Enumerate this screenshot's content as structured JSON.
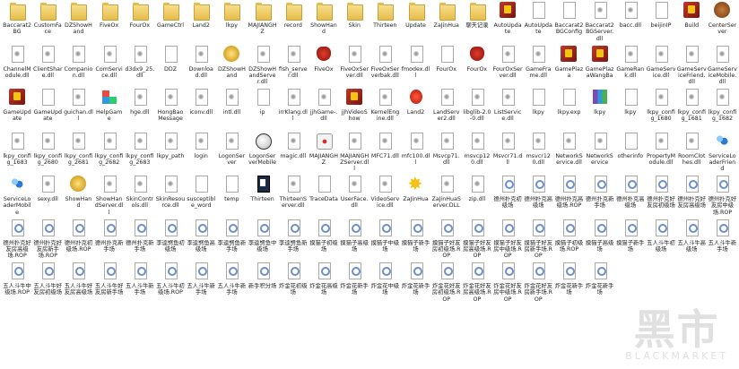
{
  "items": [
    {
      "label": "Baccarat2BG",
      "icon": "folder-icon"
    },
    {
      "label": "CustomFace",
      "icon": "folder-icon"
    },
    {
      "label": "DZShowHand",
      "icon": "folder-icon"
    },
    {
      "label": "FiveOx",
      "icon": "folder-icon"
    },
    {
      "label": "FourOx",
      "icon": "folder-icon"
    },
    {
      "label": "GameCtrl",
      "icon": "folder-icon"
    },
    {
      "label": "Land2",
      "icon": "folder-icon"
    },
    {
      "label": "lkpy",
      "icon": "folder-icon"
    },
    {
      "label": "MAJIANGHZ",
      "icon": "folder-icon"
    },
    {
      "label": "record",
      "icon": "folder-icon"
    },
    {
      "label": "ShowHand",
      "icon": "folder-icon"
    },
    {
      "label": "Skin",
      "icon": "folder-icon"
    },
    {
      "label": "Thirteen",
      "icon": "folder-icon"
    },
    {
      "label": "Update",
      "icon": "folder-icon"
    },
    {
      "label": "ZaJinHua",
      "icon": "folder-icon"
    },
    {
      "label": "聊天记录",
      "icon": "folder-icon"
    },
    {
      "label": "AutoUpdate",
      "icon": "red-app-icon"
    },
    {
      "label": "AutoUpdate",
      "icon": "file-icon"
    },
    {
      "label": "Baccarat2BGConfig",
      "icon": "file-icon"
    },
    {
      "label": "Baccarat2BGServer.dll",
      "icon": "dll-icon"
    },
    {
      "label": "bacc.dll",
      "icon": "dll-icon"
    },
    {
      "label": "beijinIP",
      "icon": "file-icon"
    },
    {
      "label": "Build",
      "icon": "red-app-icon"
    },
    {
      "label": "CenterServer",
      "icon": "brown-app-icon"
    },
    {
      "label": "ChannelModule.dll",
      "icon": "dll-icon"
    },
    {
      "label": "ClientShare.dll",
      "icon": "dll-icon"
    },
    {
      "label": "Companion.dll",
      "icon": "dll-icon"
    },
    {
      "label": "ComService.dll",
      "icon": "dll-icon"
    },
    {
      "label": "d3dx9_25.dll",
      "icon": "dll-icon"
    },
    {
      "label": "DDZ",
      "icon": "file-icon"
    },
    {
      "label": "Download.dll",
      "icon": "dll-icon"
    },
    {
      "label": "DZShowHand",
      "icon": "gold-app-icon"
    },
    {
      "label": "DZShowHandServer.dll",
      "icon": "dll-icon"
    },
    {
      "label": "fish_server.dll",
      "icon": "dll-icon"
    },
    {
      "label": "FiveOx",
      "icon": "bull-icon"
    },
    {
      "label": "FiveOxServer.dll",
      "icon": "dll-icon"
    },
    {
      "label": "FiveOxServerbak.dll",
      "icon": "dll-icon"
    },
    {
      "label": "fmodex.dll",
      "icon": "dll-icon"
    },
    {
      "label": "FourOx",
      "icon": "file-icon"
    },
    {
      "label": "FourOx",
      "icon": "bull-icon"
    },
    {
      "label": "FourOxServer.dll",
      "icon": "dll-icon"
    },
    {
      "label": "GameFrame.dll",
      "icon": "dll-icon"
    },
    {
      "label": "GamePlaza",
      "icon": "red-app-icon"
    },
    {
      "label": "GamePlazaWangBa",
      "icon": "red-app-icon"
    },
    {
      "label": "GameRank.dll",
      "icon": "dll-icon"
    },
    {
      "label": "GameService.dll",
      "icon": "dll-icon"
    },
    {
      "label": "GameServiceFriend.dll",
      "icon": "dll-icon"
    },
    {
      "label": "GameServiceMobile.dll",
      "icon": "dll-icon"
    },
    {
      "label": "GameUpdate",
      "icon": "red-app-icon"
    },
    {
      "label": "GameUpdate",
      "icon": "file-icon"
    },
    {
      "label": "guichan.dll",
      "icon": "dll-icon"
    },
    {
      "label": "HelpGame",
      "icon": "help-icon"
    },
    {
      "label": "hge.dll",
      "icon": "dll-icon"
    },
    {
      "label": "HongBaoMessage",
      "icon": "dll-icon"
    },
    {
      "label": "iconv.dll",
      "icon": "dll-icon"
    },
    {
      "label": "intl.dll",
      "icon": "dll-icon"
    },
    {
      "label": "ip",
      "icon": "file-icon"
    },
    {
      "label": "irrKlang.dll",
      "icon": "dll-icon"
    },
    {
      "label": "jjhGame-.dll",
      "icon": "dll-icon"
    },
    {
      "label": "jjhVideoShow",
      "icon": "red-app-icon"
    },
    {
      "label": "KernelEngine.dll",
      "icon": "dll-icon"
    },
    {
      "label": "Land2",
      "icon": "lantern-icon"
    },
    {
      "label": "LandServer2.dll",
      "icon": "dll-icon"
    },
    {
      "label": "libglib-2.0-0.dll",
      "icon": "dll-icon"
    },
    {
      "label": "ListService.dll",
      "icon": "dll-icon"
    },
    {
      "label": "lkpy",
      "icon": "file-icon"
    },
    {
      "label": "lkpy.exp",
      "icon": "file-icon"
    },
    {
      "label": "lkpy",
      "icon": "winrar-icon"
    },
    {
      "label": "lkpy",
      "icon": "file-icon"
    },
    {
      "label": "lkpy_config_1680",
      "icon": "dll-icon"
    },
    {
      "label": "lkpy_config_1681",
      "icon": "dll-icon"
    },
    {
      "label": "lkpy_config_1682",
      "icon": "dll-icon"
    },
    {
      "label": "lkpy_config_1683",
      "icon": "dll-icon"
    },
    {
      "label": "lkpy_config_2680",
      "icon": "dll-icon"
    },
    {
      "label": "lkpy_config_2681",
      "icon": "dll-icon"
    },
    {
      "label": "lkpy_config_2682",
      "icon": "dll-icon"
    },
    {
      "label": "lkpy_config_2683",
      "icon": "dll-icon"
    },
    {
      "label": "lkpy_path",
      "icon": "dll-icon"
    },
    {
      "label": "login",
      "icon": "dll-icon"
    },
    {
      "label": "LogonServer",
      "icon": "dll-icon"
    },
    {
      "label": "LogonServerMobile",
      "icon": "ball-icon"
    },
    {
      "label": "magic.dll",
      "icon": "dll-icon"
    },
    {
      "label": "MAJIANGHZ",
      "icon": "die-icon"
    },
    {
      "label": "MAJIANGHZServer.dll",
      "icon": "dll-icon"
    },
    {
      "label": "MFC71.dll",
      "icon": "dll-icon"
    },
    {
      "label": "mfc100.dll",
      "icon": "dll-icon"
    },
    {
      "label": "Msvcp71.dll",
      "icon": "dll-icon"
    },
    {
      "label": "msvcp120.dll",
      "icon": "dll-icon"
    },
    {
      "label": "Msvcr71.dll",
      "icon": "dll-icon"
    },
    {
      "label": "msvcr120.dll",
      "icon": "dll-icon"
    },
    {
      "label": "NetworkService.dll",
      "icon": "dll-icon"
    },
    {
      "label": "NetworkService",
      "icon": "dll-icon"
    },
    {
      "label": "otherinfo",
      "icon": "file-icon"
    },
    {
      "label": "PropertyModule.dll",
      "icon": "dll-icon"
    },
    {
      "label": "RoomClothes.dll",
      "icon": "dll-icon"
    },
    {
      "label": "ServiceLoaderFriend",
      "icon": "people-icon"
    },
    {
      "label": "ServiceLoaderMobile",
      "icon": "people-icon"
    },
    {
      "label": "sexy.dll",
      "icon": "dll-icon"
    },
    {
      "label": "ShowHand",
      "icon": "gold-app-icon"
    },
    {
      "label": "ShowHandServer.dll",
      "icon": "dll-icon"
    },
    {
      "label": "SkinControls.dll",
      "icon": "dll-icon"
    },
    {
      "label": "SkinResource.dll",
      "icon": "dll-icon"
    },
    {
      "label": "susceptible_word",
      "icon": "file-icon"
    },
    {
      "label": "temp",
      "icon": "file-icon"
    },
    {
      "label": "Thirteen",
      "icon": "card-icon"
    },
    {
      "label": "ThirteenServer.dll",
      "icon": "dll-icon"
    },
    {
      "label": "TraceData",
      "icon": "file-icon"
    },
    {
      "label": "UserFace.dll",
      "icon": "dll-icon"
    },
    {
      "label": "VideoService.dll",
      "icon": "dll-icon"
    },
    {
      "label": "ZaJinHua",
      "icon": "star-icon"
    },
    {
      "label": "ZaJinHuaServer.DLL",
      "icon": "dll-icon"
    },
    {
      "label": "zip.dll",
      "icon": "dll-icon"
    },
    {
      "label": "德州扑克初级场",
      "icon": "rop-icon"
    },
    {
      "label": "德州扑克高级场",
      "icon": "rop-icon"
    },
    {
      "label": "德州扑克高级场.ROP",
      "icon": "rop-icon"
    },
    {
      "label": "德州扑克新手场",
      "icon": "rop-icon"
    },
    {
      "label": "德州扑克高级场",
      "icon": "rop-icon"
    },
    {
      "label": "德州扑克好友房初级场",
      "icon": "rop-icon"
    },
    {
      "label": "德州扑克好友房高级场",
      "icon": "rop-icon"
    },
    {
      "label": "德州扑克好友房中级场.ROP",
      "icon": "rop-icon"
    },
    {
      "label": "德州扑克好友房高级场.ROP",
      "icon": "rop-icon"
    },
    {
      "label": "德州扑克好友房新手场.ROP",
      "icon": "rop-icon"
    },
    {
      "label": "德州扑克初级场.ROP",
      "icon": "rop-icon"
    },
    {
      "label": "德州扑克新手场",
      "icon": "rop-icon"
    },
    {
      "label": "德州扑克新手场",
      "icon": "rop-icon"
    },
    {
      "label": "李逵劈鱼初级场",
      "icon": "rop-icon"
    },
    {
      "label": "李逵劈鱼高级场",
      "icon": "rop-icon"
    },
    {
      "label": "李逵劈鱼新手场",
      "icon": "rop-icon"
    },
    {
      "label": "李逵劈鱼中级场",
      "icon": "rop-icon"
    },
    {
      "label": "李逵劈鱼新手场",
      "icon": "rop-icon"
    },
    {
      "label": "摸猫子初级场",
      "icon": "rop-icon"
    },
    {
      "label": "摸猫子高级场",
      "icon": "rop-icon"
    },
    {
      "label": "摸猫子中级场",
      "icon": "rop-icon"
    },
    {
      "label": "摸猫子新手场",
      "icon": "rop-icon"
    },
    {
      "label": "摸猫子好友房初级场.ROP",
      "icon": "rop-icon"
    },
    {
      "label": "摸猫子好友房高级场.ROP",
      "icon": "rop-icon"
    },
    {
      "label": "摸猫子好友房中级场.ROP",
      "icon": "rop-icon"
    },
    {
      "label": "摸猫子好友房新手场.ROP",
      "icon": "rop-icon"
    },
    {
      "label": "摸猫子初级场.ROP",
      "icon": "rop-icon"
    },
    {
      "label": "摸猫子高级场",
      "icon": "rop-icon"
    },
    {
      "label": "摸猫子新手场",
      "icon": "rop-icon"
    },
    {
      "label": "五人斗牛初级场",
      "icon": "rop-icon"
    },
    {
      "label": "五人斗牛高级场",
      "icon": "rop-icon"
    },
    {
      "label": "五人斗牛新手场",
      "icon": "rop-icon"
    },
    {
      "label": "五人斗牛中级场.ROP",
      "icon": "rop-icon"
    },
    {
      "label": "五人斗牛好友房初级场",
      "icon": "rop-icon"
    },
    {
      "label": "五人斗牛好友房高级场",
      "icon": "rop-icon"
    },
    {
      "label": "五人斗牛好友房新手场",
      "icon": "rop-icon"
    },
    {
      "label": "五人斗牛新手场",
      "icon": "rop-icon"
    },
    {
      "label": "五人斗牛初级场.ROP",
      "icon": "rop-icon"
    },
    {
      "label": "五人斗牛新手场",
      "icon": "rop-icon"
    },
    {
      "label": "五人斗牛新手场",
      "icon": "rop-icon"
    },
    {
      "label": "新手积分场",
      "icon": "rop-icon"
    },
    {
      "label": "炸金花初级场",
      "icon": "rop-icon"
    },
    {
      "label": "炸金花高级场",
      "icon": "rop-icon"
    },
    {
      "label": "炸金花新手场",
      "icon": "rop-icon"
    },
    {
      "label": "炸金花中级场",
      "icon": "rop-icon"
    },
    {
      "label": "炸金花新手场",
      "icon": "rop-icon"
    },
    {
      "label": "炸金花好友房初级场.ROP",
      "icon": "rop-icon"
    },
    {
      "label": "炸金花好友房高级场.ROP",
      "icon": "rop-icon"
    },
    {
      "label": "炸金花好友房中级场.ROP",
      "icon": "rop-icon"
    },
    {
      "label": "炸金花好友房新手场.ROP",
      "icon": "rop-icon"
    },
    {
      "label": "炸金花新手场",
      "icon": "rop-icon"
    },
    {
      "label": "炸金花新手场",
      "icon": "rop-icon"
    }
  ],
  "watermark": {
    "big": "黑市",
    "small": "BLACKMARKET"
  }
}
